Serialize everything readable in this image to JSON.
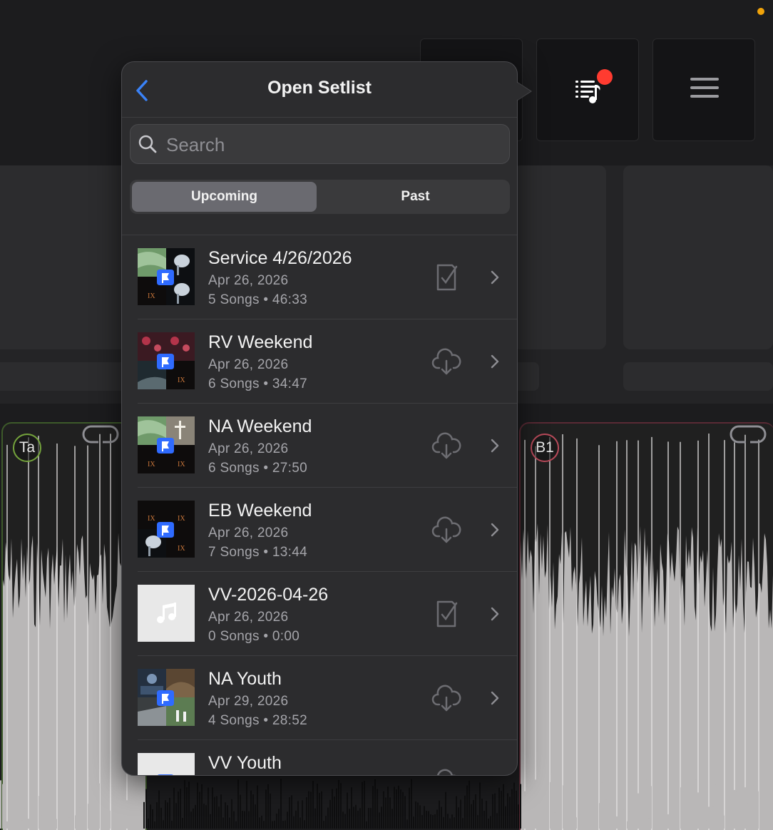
{
  "status": {
    "indicator_color": "#f0a30a"
  },
  "toolbar": {
    "setlist_badge_color": "#ff3b30"
  },
  "tracks": {
    "left": {
      "tag": "Ta",
      "color": "#74a33c"
    },
    "right": {
      "tag": "B1",
      "color": "#b84a5a"
    }
  },
  "popover": {
    "title": "Open Setlist",
    "search": {
      "placeholder": "Search",
      "value": ""
    },
    "segments": {
      "active": "Upcoming",
      "inactive": "Past"
    },
    "setlists": [
      {
        "title": "Service 4/26/2026",
        "date": "Apr 26, 2026",
        "meta": "5 Songs • 46:33",
        "status_icon": "checklist-icon"
      },
      {
        "title": "RV Weekend",
        "date": "Apr 26, 2026",
        "meta": "6 Songs • 34:47",
        "status_icon": "cloud-download-icon"
      },
      {
        "title": "NA Weekend",
        "date": "Apr 26, 2026",
        "meta": "6 Songs • 27:50",
        "status_icon": "cloud-download-icon"
      },
      {
        "title": "EB Weekend",
        "date": "Apr 26, 2026",
        "meta": "7 Songs • 13:44",
        "status_icon": "cloud-download-icon"
      },
      {
        "title": "VV-2026-04-26",
        "date": "Apr 26, 2026",
        "meta": "0 Songs • 0:00",
        "status_icon": "checklist-icon"
      },
      {
        "title": "NA Youth",
        "date": "Apr 29, 2026",
        "meta": "4 Songs • 28:52",
        "status_icon": "cloud-download-icon"
      },
      {
        "title": "VV Youth",
        "date": "",
        "meta": "",
        "status_icon": "cloud-download-icon"
      }
    ]
  },
  "colors": {
    "accent_blue": "#3a82f7",
    "planning_center_badge": "#2f6bff",
    "popover_bg": "#2c2c2e",
    "segment_active_bg": "#6a6a70"
  }
}
